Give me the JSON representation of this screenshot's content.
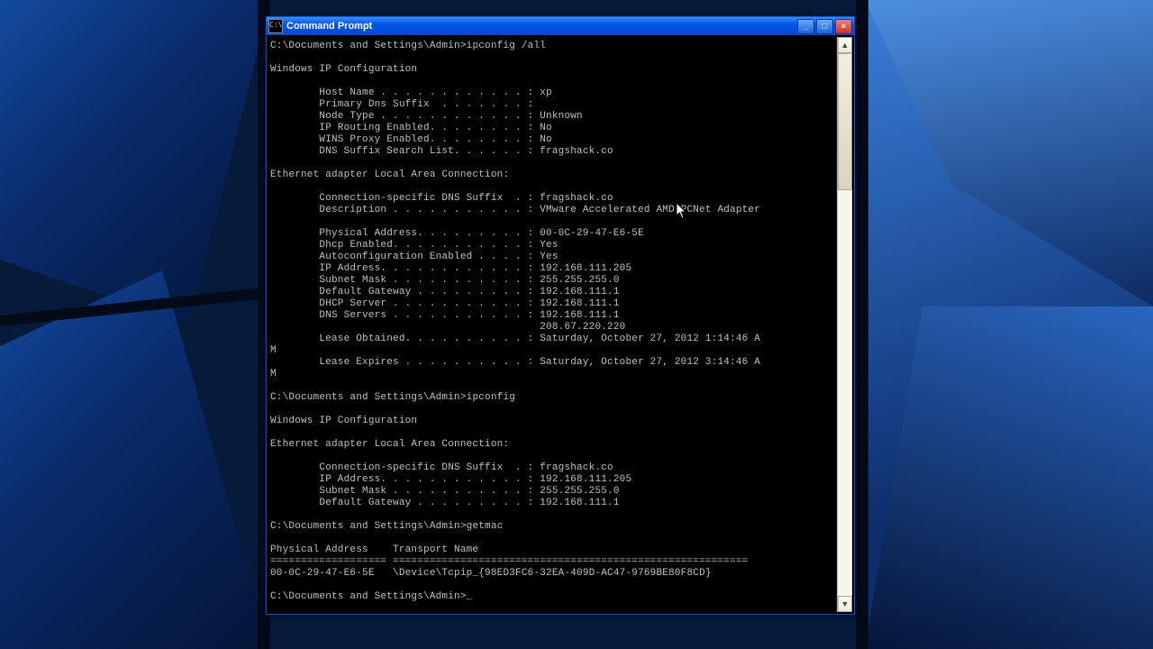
{
  "window": {
    "title": "Command Prompt"
  },
  "buttons": {
    "min": "_",
    "max": "□",
    "close": "×"
  },
  "term": {
    "prompt": "C:\\Documents and Settings\\Admin>",
    "cmd1": "ipconfig /all",
    "hdr": "Windows IP Configuration",
    "hostname": "        Host Name . . . . . . . . . . . . : xp",
    "dnssuf": "        Primary Dns Suffix  . . . . . . . :",
    "nodetype": "        Node Type . . . . . . . . . . . . : Unknown",
    "iprouting": "        IP Routing Enabled. . . . . . . . : No",
    "winsproxy": "        WINS Proxy Enabled. . . . . . . . : No",
    "suflist": "        DNS Suffix Search List. . . . . . : fragshack.co",
    "adapterhdr": "Ethernet adapter Local Area Connection:",
    "cdns": "        Connection-specific DNS Suffix  . : fragshack.co",
    "desc": "        Description . . . . . . . . . . . : VMware Accelerated AMD PCNet Adapter",
    "phys": "        Physical Address. . . . . . . . . : 00-0C-29-47-E6-5E",
    "dhcp": "        Dhcp Enabled. . . . . . . . . . . : Yes",
    "autocfg": "        Autoconfiguration Enabled . . . . : Yes",
    "ip": "        IP Address. . . . . . . . . . . . : 192.168.111.205",
    "mask": "        Subnet Mask . . . . . . . . . . . : 255.255.255.0",
    "gw": "        Default Gateway . . . . . . . . . : 192.168.111.1",
    "dhcpsrv": "        DHCP Server . . . . . . . . . . . : 192.168.111.1",
    "dns1": "        DNS Servers . . . . . . . . . . . : 192.168.111.1",
    "dns2": "                                            208.67.220.220",
    "lease1": "        Lease Obtained. . . . . . . . . . : Saturday, October 27, 2012 1:14:46 A",
    "m1": "M",
    "lease2": "        Lease Expires . . . . . . . . . . : Saturday, October 27, 2012 3:14:46 A",
    "m2": "M",
    "cmd2": "ipconfig",
    "cmd3": "getmac",
    "getmac_hdr": "Physical Address    Transport Name",
    "getmac_sep": "=================== ==========================================================",
    "getmac_row": "00-0C-29-47-E6-5E   \\Device\\Tcpip_{98ED3FC6-32EA-409D-AC47-9769BE80F8CD}",
    "cursor": "_"
  }
}
